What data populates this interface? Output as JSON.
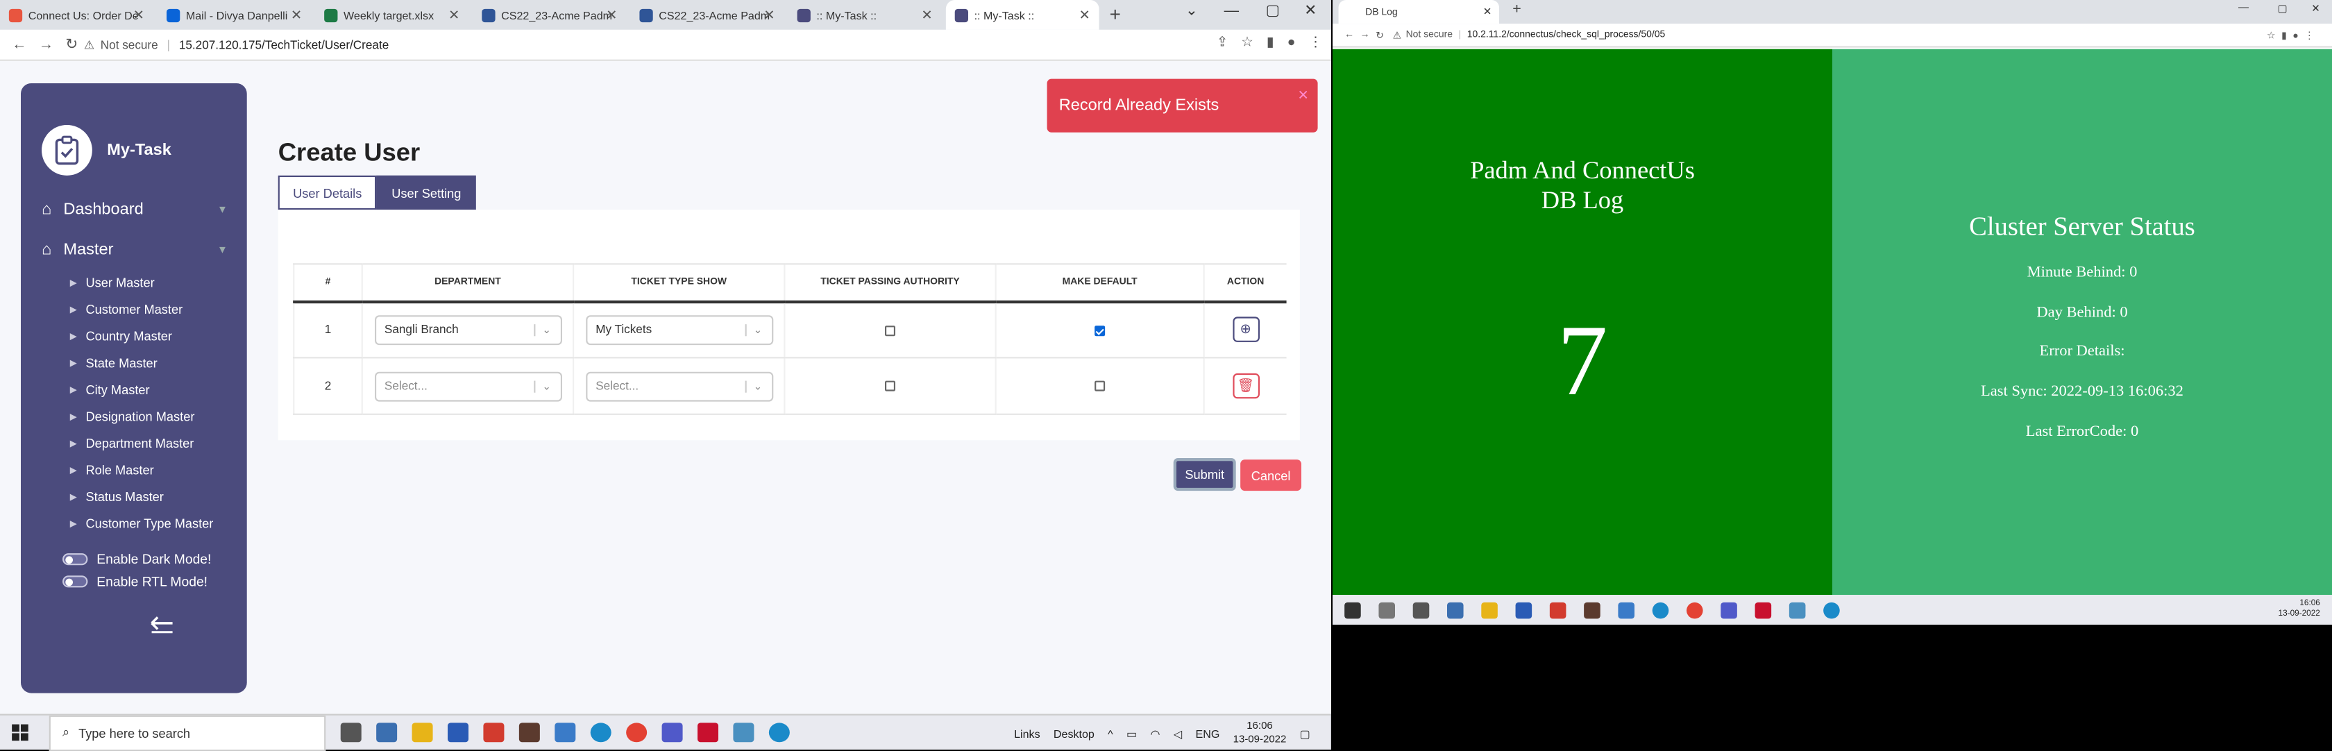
{
  "left_browser": {
    "tabs": [
      {
        "title": "Connect Us: Order De",
        "color": "#e8553f"
      },
      {
        "title": "Mail - Divya Danpelli",
        "color": "#0a64d8"
      },
      {
        "title": "Weekly target.xlsx",
        "color": "#1d7a45"
      },
      {
        "title": "CS22_23-Acme Padm",
        "color": "#2f5597"
      },
      {
        "title": "CS22_23-Acme Padm",
        "color": "#2f5597"
      },
      {
        "title": ":: My-Task ::",
        "color": "#4b4b7d"
      },
      {
        "title": ":: My-Task ::",
        "color": "#4b4b7d"
      }
    ],
    "security": "Not secure",
    "url": "15.207.120.175/TechTicket/User/Create"
  },
  "sidebar": {
    "brand": "My-Task",
    "top_items": [
      {
        "label": "Dashboard"
      },
      {
        "label": "Master"
      }
    ],
    "sub_items": [
      {
        "label": "User Master"
      },
      {
        "label": "Customer Master"
      },
      {
        "label": "Country Master"
      },
      {
        "label": "State Master"
      },
      {
        "label": "City Master"
      },
      {
        "label": "Designation Master"
      },
      {
        "label": "Department Master"
      },
      {
        "label": "Role Master"
      },
      {
        "label": "Status Master"
      },
      {
        "label": "Customer Type Master"
      }
    ],
    "toggles": [
      {
        "label": "Enable Dark Mode!"
      },
      {
        "label": "Enable RTL Mode!"
      }
    ]
  },
  "main": {
    "title": "Create User",
    "tabs": [
      {
        "label": "User Details"
      },
      {
        "label": "User Setting"
      }
    ],
    "table": {
      "headers": [
        "#",
        "DEPARTMENT",
        "TICKET TYPE SHOW",
        "TICKET PASSING AUTHORITY",
        "MAKE DEFAULT",
        "ACTION"
      ],
      "rows": [
        {
          "num": "1",
          "department": "Sangli Branch",
          "ticket_type": "My Tickets",
          "passing_authority": false,
          "make_default": true,
          "action": "add"
        },
        {
          "num": "2",
          "department": "Select...",
          "ticket_type": "Select...",
          "passing_authority": false,
          "make_default": false,
          "action": "delete"
        }
      ]
    },
    "submit_label": "Submit",
    "cancel_label": "Cancel",
    "toast": "Record Already Exists"
  },
  "taskbar": {
    "search_placeholder": "Type here to search",
    "links": "Links",
    "desktop": "Desktop",
    "lang": "ENG",
    "time": "16:06",
    "date": "13-09-2022"
  },
  "right_browser": {
    "tab_title": "DB Log",
    "security": "Not secure",
    "url": "10.2.11.2/connectus/check_sql_process/50/05",
    "left_title_line1": "Padm And ConnectUs",
    "left_title_line2": "DB Log",
    "big_number": "7",
    "right_title": "Cluster Server Status",
    "stats": [
      "Minute Behind: 0",
      "Day Behind: 0",
      "Error Details:",
      "Last Sync: 2022-09-13 16:06:32",
      "Last ErrorCode: 0"
    ],
    "time": "16:06",
    "date": "13-09-2022"
  }
}
